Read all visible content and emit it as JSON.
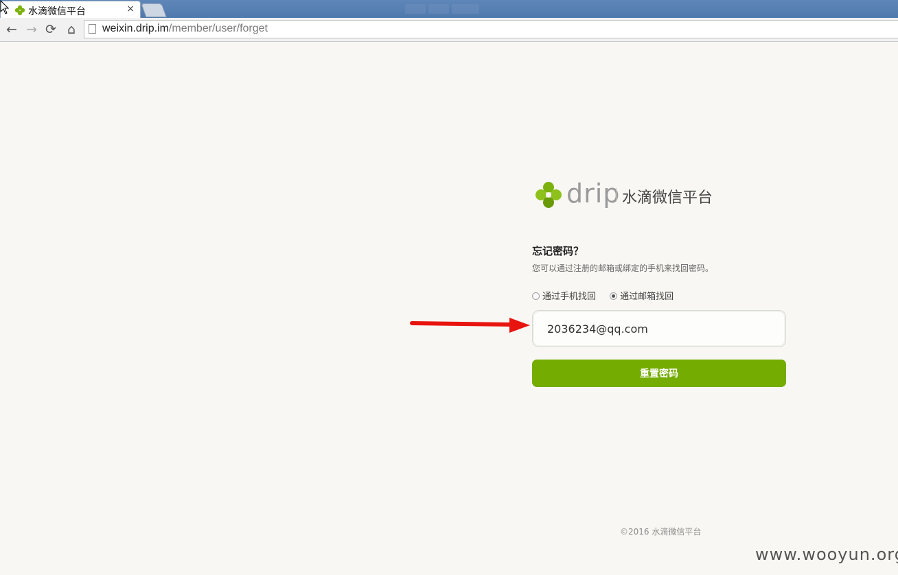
{
  "browser": {
    "tab_title": "水滴微信平台",
    "tab_close": "×",
    "address_host": "weixin.drip.im",
    "address_path": "/member/user/forget",
    "nav": {
      "back": "←",
      "forward": "→",
      "reload": "⟳",
      "home": "⌂"
    }
  },
  "logo": {
    "wordmark": "drip",
    "brand_name": "水滴微信平台",
    "accent_color": "#7cb10e"
  },
  "form": {
    "title": "忘记密码？",
    "description": "您可以通过注册的邮箱或绑定的手机来找回密码。",
    "options": [
      {
        "label": "通过手机找回",
        "selected": false
      },
      {
        "label": "通过邮箱找回",
        "selected": true
      }
    ],
    "email_value": "2036234@qq.com",
    "submit_label": "重置密码",
    "button_color": "#74ac02"
  },
  "footer": {
    "copyright": "©2016 水滴微信平台"
  },
  "watermark": "www.wooyun.org",
  "annotation": {
    "arrow_color": "#e8140f"
  }
}
